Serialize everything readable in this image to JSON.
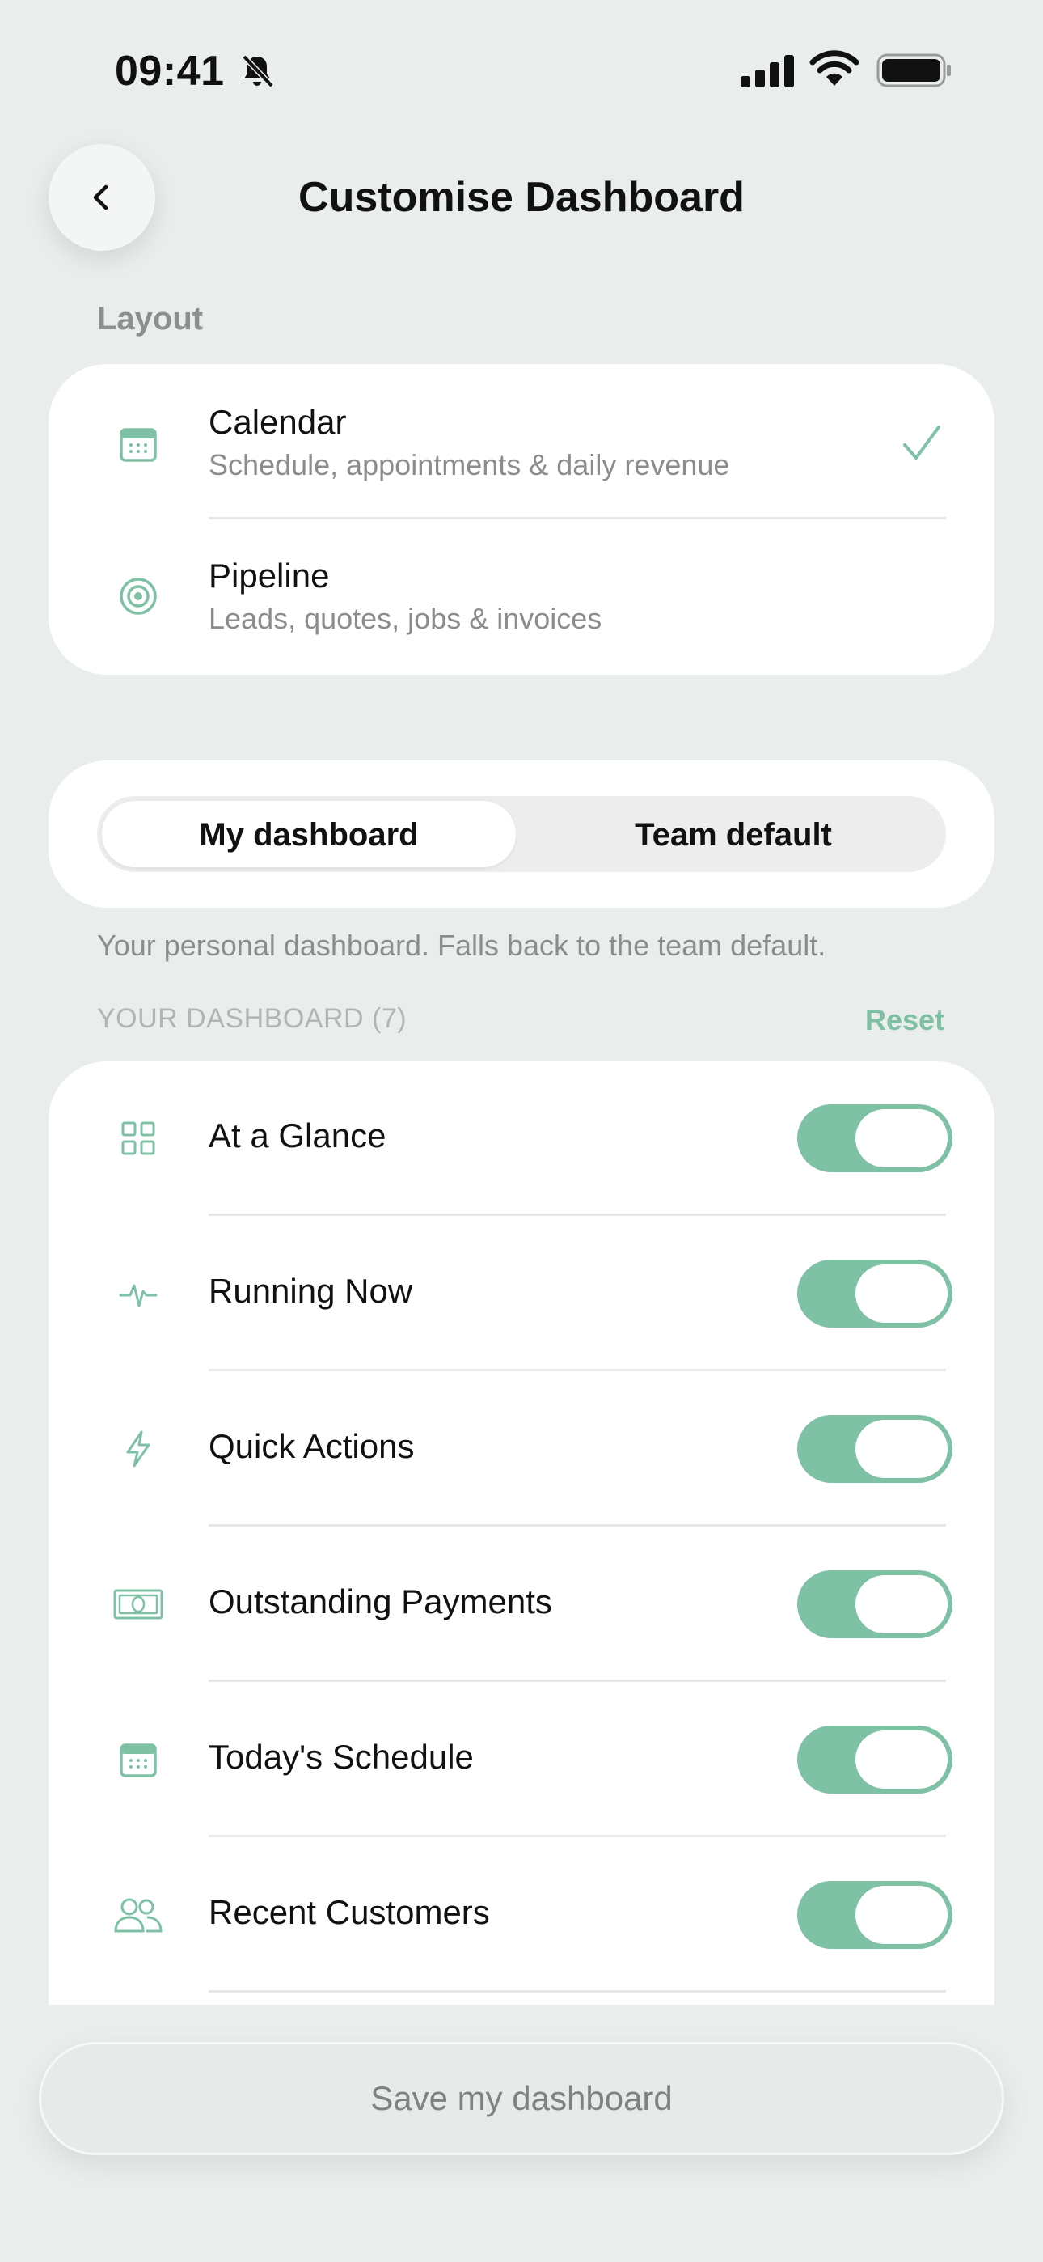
{
  "status_bar": {
    "time": "09:41"
  },
  "header": {
    "title": "Customise Dashboard"
  },
  "layout_section": {
    "label": "Layout",
    "options": [
      {
        "title": "Calendar",
        "subtitle": "Schedule, appointments & daily revenue",
        "icon": "calendar-icon",
        "selected": true
      },
      {
        "title": "Pipeline",
        "subtitle": "Leads, quotes, jobs & invoices",
        "icon": "target-icon",
        "selected": false
      }
    ]
  },
  "segmented": {
    "options": [
      "My dashboard",
      "Team default"
    ],
    "selected": "My dashboard"
  },
  "helper_text": "Your personal dashboard. Falls back to the team default.",
  "widgets": {
    "heading": "YOUR DASHBOARD (7)",
    "reset_label": "Reset",
    "items": [
      {
        "label": "At a Glance",
        "icon": "grid-icon",
        "enabled": true
      },
      {
        "label": "Running Now",
        "icon": "pulse-icon",
        "enabled": true
      },
      {
        "label": "Quick Actions",
        "icon": "lightning-icon",
        "enabled": true
      },
      {
        "label": "Outstanding Payments",
        "icon": "banknote-icon",
        "enabled": true
      },
      {
        "label": "Today's Schedule",
        "icon": "calendar-icon",
        "enabled": true
      },
      {
        "label": "Recent Customers",
        "icon": "users-icon",
        "enabled": true
      }
    ]
  },
  "save_button": {
    "label": "Save my dashboard"
  },
  "colors": {
    "accent": "#7fc1a5",
    "background": "#e9edec",
    "card": "#ffffff"
  }
}
